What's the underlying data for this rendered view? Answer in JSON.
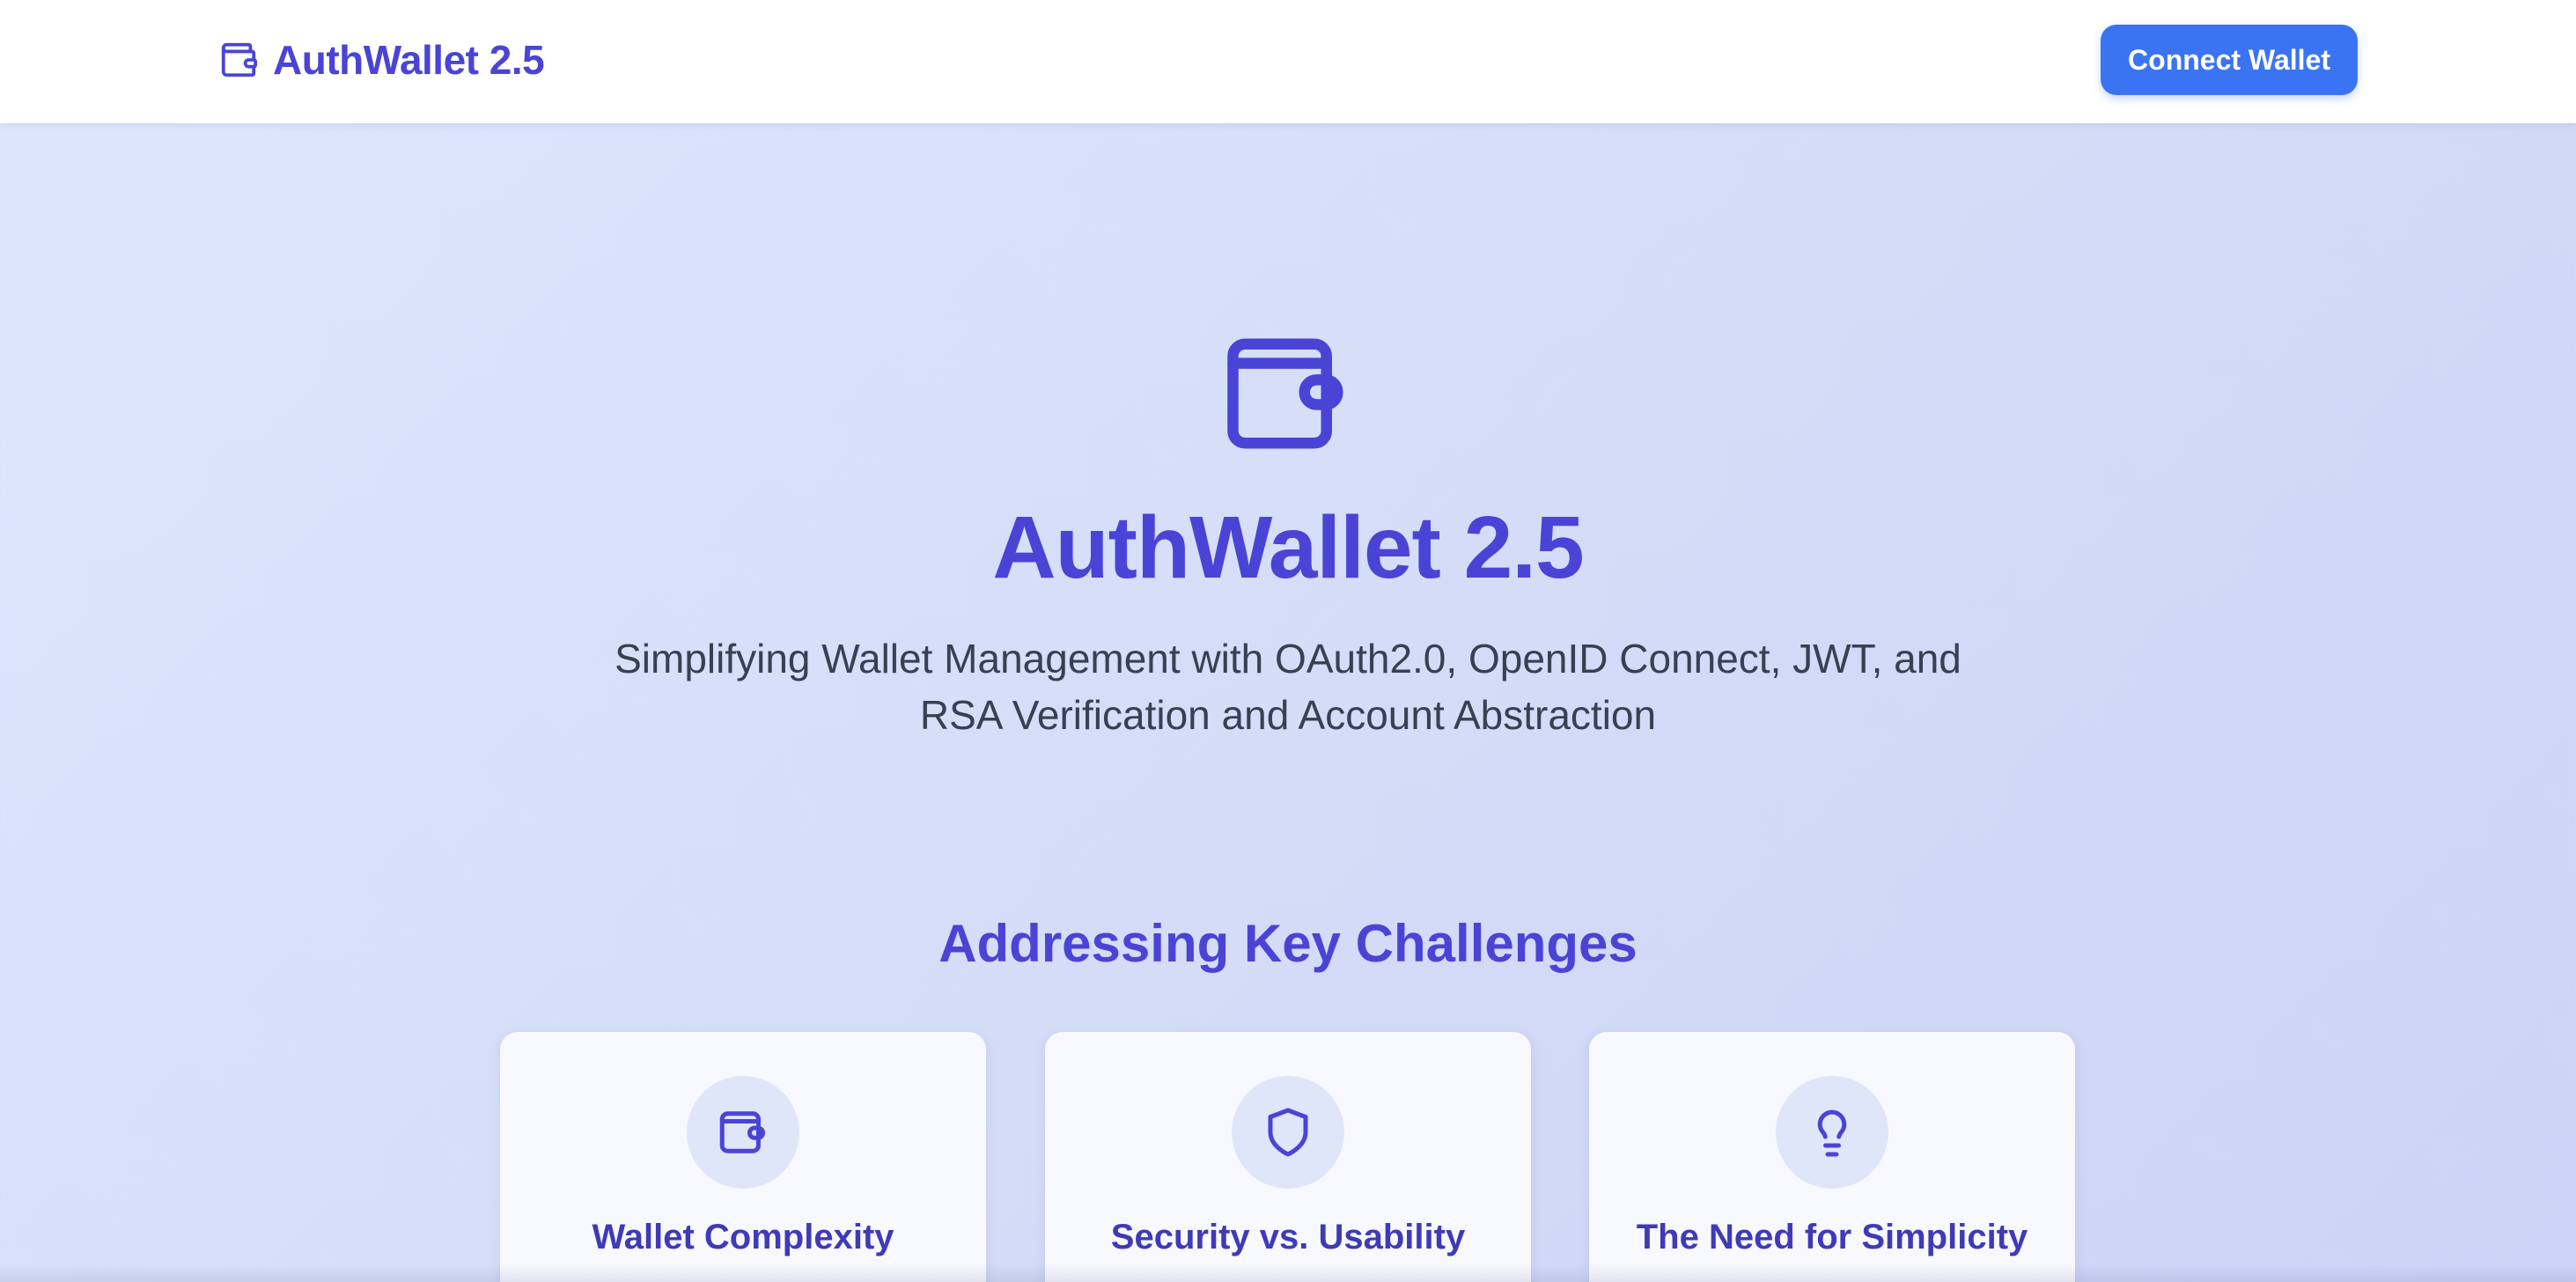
{
  "header": {
    "brand_icon": "wallet-icon",
    "brand_name": "AuthWallet 2.5",
    "connect_label": "Connect Wallet"
  },
  "hero": {
    "icon": "wallet-icon",
    "title": "AuthWallet 2.5",
    "subtitle": "Simplifying Wallet Management with OAuth2.0, OpenID Connect, JWT, and RSA Verification and Account Abstraction"
  },
  "challenges": {
    "title": "Addressing Key Challenges",
    "cards": [
      {
        "icon": "wallet-icon",
        "title": "Wallet Complexity"
      },
      {
        "icon": "shield-icon",
        "title": "Security vs. Usability"
      },
      {
        "icon": "lightbulb-icon",
        "title": "The Need for Simplicity"
      }
    ]
  },
  "colors": {
    "brand": "#4a44d6",
    "button": "#3b74f3",
    "background_start": "#dde7fb",
    "background_end": "#ccd3f6",
    "card_bg": "#f8f9fe",
    "icon_circle": "#e0e6fa"
  }
}
